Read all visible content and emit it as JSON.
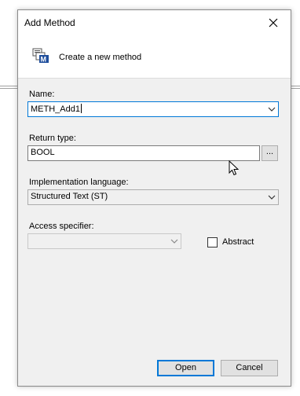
{
  "dialog": {
    "title": "Add Method",
    "header_text": "Create a new method"
  },
  "form": {
    "name_label": "Name:",
    "name_value": "METH_Add1",
    "return_type_label": "Return type:",
    "return_type_value": "BOOL",
    "browse_label": "...",
    "impl_lang_label": "Implementation language:",
    "impl_lang_value": "Structured Text (ST)",
    "access_label": "Access specifier:",
    "access_value": "",
    "abstract_label": "Abstract",
    "abstract_checked": false
  },
  "buttons": {
    "open": "Open",
    "cancel": "Cancel"
  },
  "icons": {
    "close": "close-icon",
    "method": "method-icon",
    "dropdown": "chevron-down-icon"
  },
  "colors": {
    "focus": "#0078d7",
    "dialog_bg": "#f0f0f0",
    "icon_blue": "#1f4e9c"
  }
}
